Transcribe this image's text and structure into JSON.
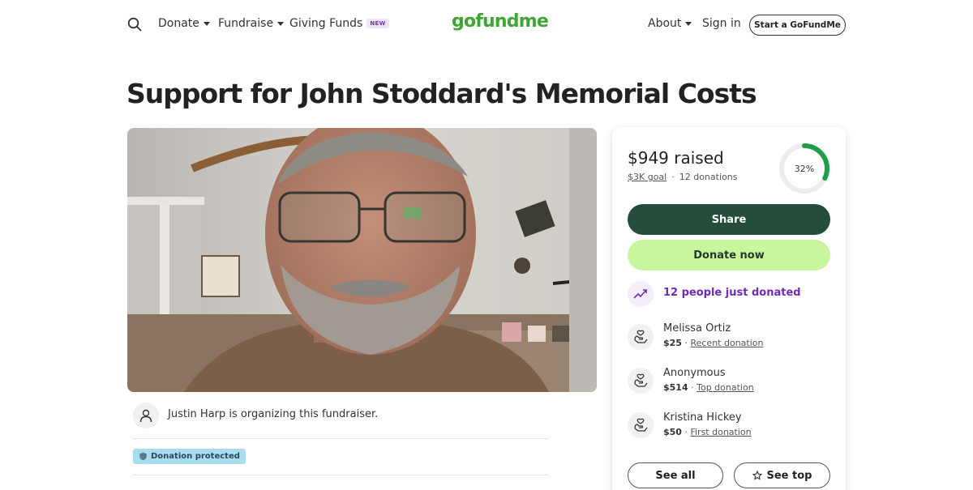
{
  "header": {
    "search_icon": "search-icon",
    "nav_left": [
      {
        "label": "Donate",
        "has_caret": true
      },
      {
        "label": "Fundraise",
        "has_caret": true
      },
      {
        "label": "Giving Funds",
        "badge": "NEW"
      }
    ],
    "logo_text": "gofundme",
    "nav_right": [
      {
        "label": "About",
        "has_caret": true
      },
      {
        "label": "Sign in"
      }
    ],
    "cta_label": "Start a GoFundMe"
  },
  "campaign": {
    "title": "Support for John Stoddard's Memorial Costs",
    "organizer_text": "Justin Harp is organizing this fundraiser.",
    "protected_label": "Donation protected"
  },
  "stats": {
    "raised_amount": "$949",
    "raised_word": "raised",
    "goal": "$3K goal",
    "donations_count": "12 donations",
    "progress_label": "32%",
    "progress_fraction": 0.32
  },
  "actions": {
    "share_label": "Share",
    "donate_label": "Donate now",
    "see_all_label": "See all",
    "see_top_label": "See top"
  },
  "activity": {
    "trend_text": "12 people just donated",
    "donors": [
      {
        "name": "Melissa Ortiz",
        "amount": "$25",
        "kind": "Recent donation"
      },
      {
        "name": "Anonymous",
        "amount": "$514",
        "kind": "Top donation"
      },
      {
        "name": "Kristina Hickey",
        "amount": "$50",
        "kind": "First donation"
      }
    ]
  },
  "colors": {
    "brand_green": "#3fa535",
    "share_bg": "#244d3b",
    "donate_bg": "#c9f59f",
    "trend_purple": "#6e2bb5",
    "ring_green": "#1f9d4c",
    "protected_bg": "#a9dcef"
  }
}
